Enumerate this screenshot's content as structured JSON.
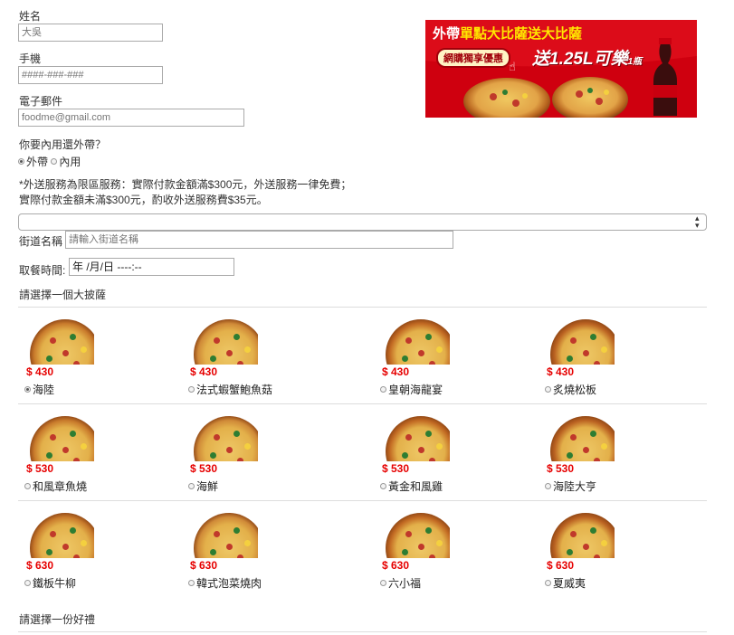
{
  "form": {
    "name_label": "姓名",
    "name_placeholder": "大吳",
    "phone_label": "手機",
    "phone_placeholder": "####-###-###",
    "email_label": "電子郵件",
    "email_placeholder": "foodme@gmail.com",
    "dine_question": "你要內用還外帶？",
    "option_takeout": "外帶",
    "option_dinein": "內用",
    "selected_option": "外帶",
    "delivery_notice_1": "*外送服務為限區服務：實際付款金額滿$300元，外送服務一律免費；",
    "delivery_notice_2": "實際付款金額未滿$300元，酌收外送服務費$35元。",
    "street_label": "街道名稱",
    "street_placeholder": "請輸入街道名稱",
    "pickup_label": "取餐時間:",
    "pickup_value": "年 /月/日 ----:--",
    "pizza_heading": "請選擇一個大披薩",
    "gift_heading": "請選擇一份好禮"
  },
  "ad": {
    "line1_a": "外帶",
    "line1_b": "單點大比薩送大比薩",
    "badge": "網購獨享優惠",
    "offer": "送1.25L可樂",
    "offer_unit": "1瓶",
    "bottle_label": "Coca-Cola"
  },
  "pizzas": [
    {
      "price": "$ 430",
      "name": "海陸",
      "selected": true
    },
    {
      "price": "$ 430",
      "name": "法式蝦蟹鮑魚菇",
      "selected": false
    },
    {
      "price": "$ 430",
      "name": "皇朝海龍宴",
      "selected": false
    },
    {
      "price": "$ 430",
      "name": "炙燒松板",
      "selected": false
    },
    {
      "price": "$ 530",
      "name": "和風章魚燒",
      "selected": false
    },
    {
      "price": "$ 530",
      "name": "海鮮",
      "selected": false
    },
    {
      "price": "$ 530",
      "name": "黃金和風雞",
      "selected": false
    },
    {
      "price": "$ 530",
      "name": "海陸大亨",
      "selected": false
    },
    {
      "price": "$ 630",
      "name": "鐵板牛柳",
      "selected": false
    },
    {
      "price": "$ 630",
      "name": "韓式泡菜燒肉",
      "selected": false
    },
    {
      "price": "$ 630",
      "name": "六小福",
      "selected": false
    },
    {
      "price": "$ 630",
      "name": "夏威夷",
      "selected": false
    }
  ],
  "colors": {
    "price": "#e60000",
    "ad_red": "#d5000f",
    "ad_yellow": "#ffe600"
  }
}
